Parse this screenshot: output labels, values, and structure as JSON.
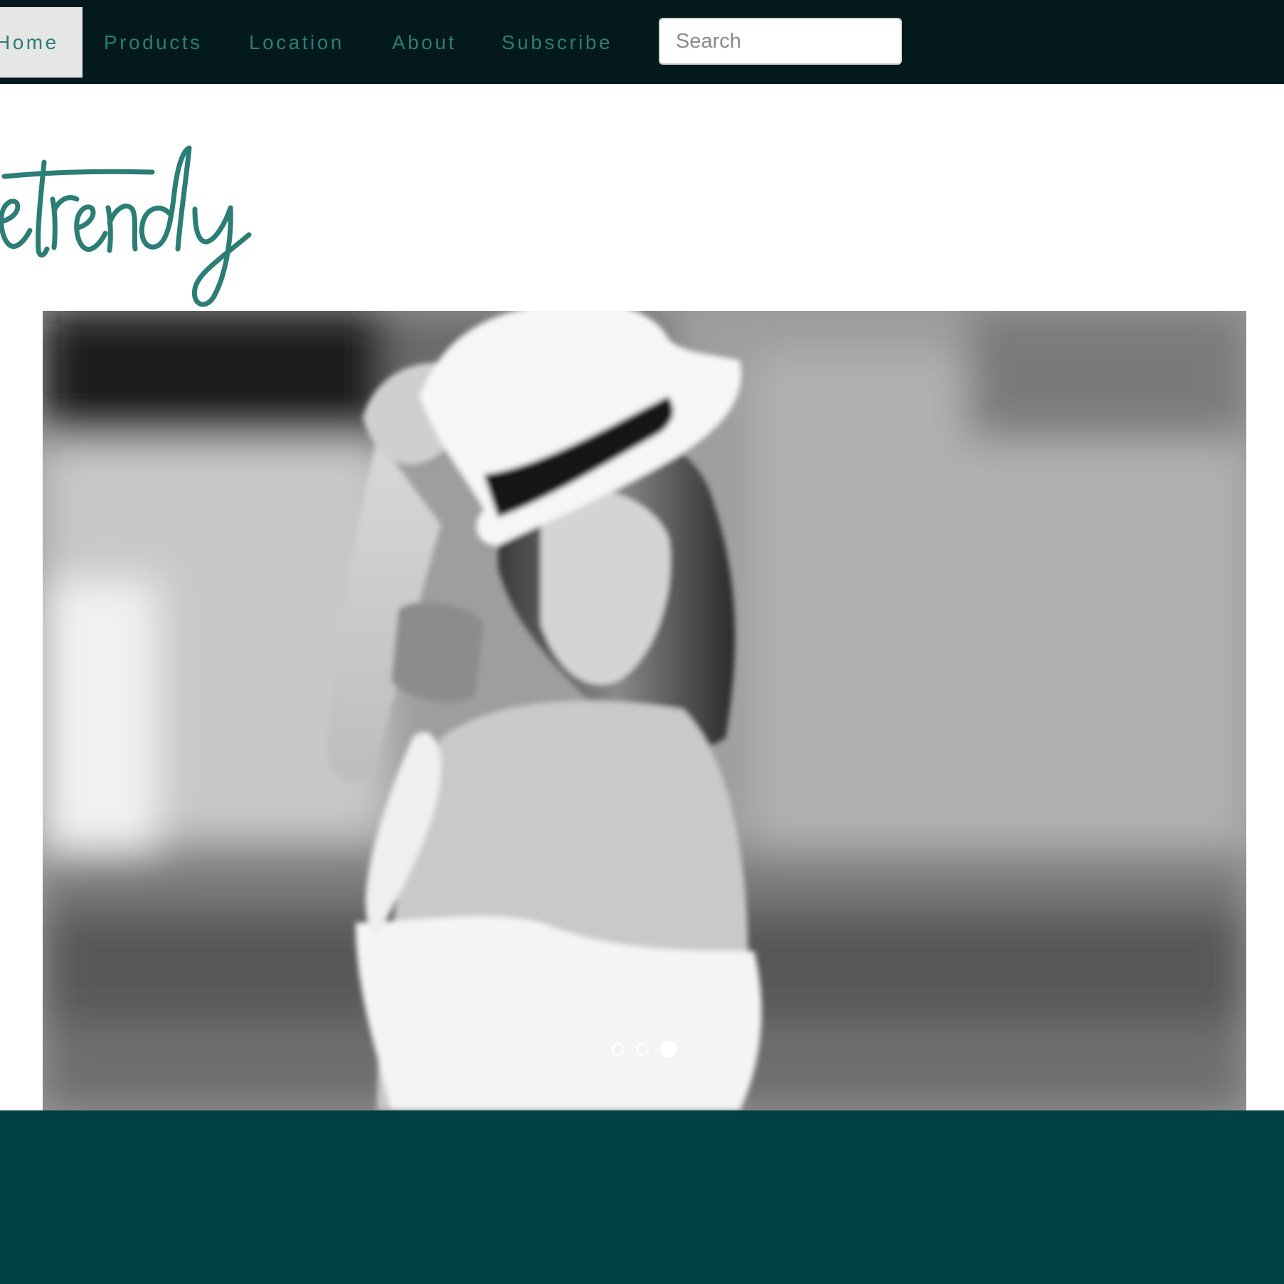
{
  "nav": {
    "items": [
      {
        "label": "Home",
        "active": true
      },
      {
        "label": "Products",
        "active": false
      },
      {
        "label": "Location",
        "active": false
      },
      {
        "label": "About",
        "active": false
      },
      {
        "label": "Subscribe",
        "active": false
      }
    ],
    "search_placeholder": "Search"
  },
  "brand": {
    "logo_text": "etrendy",
    "accent_color": "#2c7d76"
  },
  "carousel": {
    "slide_count": 3,
    "active_index": 2
  },
  "colors": {
    "nav_bg": "#03191c",
    "footer_bg": "#004146",
    "active_nav_bg": "#e6e6e6"
  }
}
